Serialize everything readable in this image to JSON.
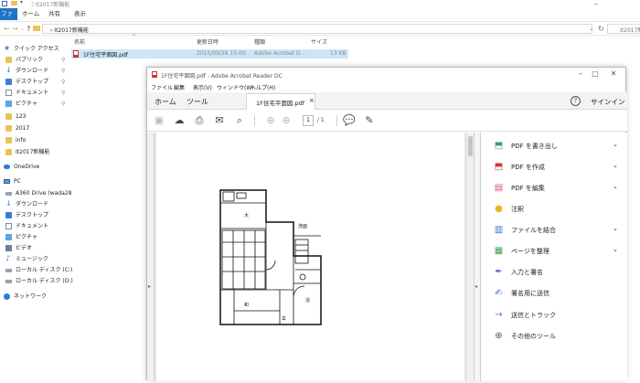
{
  "explorer": {
    "title": "ﾌ It2017新機能",
    "ribbon_tabs": [
      "ファイル",
      "ホーム",
      "共有",
      "表示"
    ],
    "address_path": "› It2017新機能",
    "search_placeholder": "It2017新機能",
    "columns": {
      "name": "名前",
      "date": "更新日時",
      "type": "種類",
      "size": "サイズ"
    },
    "file": {
      "name": "1F住宅平面図.pdf",
      "date": "2015/09/28 15:00",
      "type": "Adobe Acrobat D...",
      "size": "13 KB"
    },
    "nav": [
      {
        "label": "クイック アクセス",
        "icon": "star-icon"
      },
      {
        "label": "パブリック",
        "icon": "folder-icon",
        "pinned": true
      },
      {
        "label": "ダウンロード",
        "icon": "download-icon",
        "pinned": true
      },
      {
        "label": "デスクトップ",
        "icon": "desktop-icon",
        "pinned": true
      },
      {
        "label": "ドキュメント",
        "icon": "document-icon",
        "pinned": true
      },
      {
        "label": "ピクチャ",
        "icon": "pictures-icon",
        "pinned": true
      },
      {
        "label": "123",
        "icon": "folder-icon"
      },
      {
        "label": "2017",
        "icon": "folder-icon"
      },
      {
        "label": "info",
        "icon": "folder-icon"
      },
      {
        "label": "It2017新機能",
        "icon": "folder-icon"
      },
      {
        "label": "OneDrive",
        "icon": "onedrive-icon"
      },
      {
        "label": "PC",
        "icon": "pc-icon"
      },
      {
        "label": "A360 Drive (wada28",
        "icon": "drive-icon"
      },
      {
        "label": "ダウンロード",
        "icon": "download-icon"
      },
      {
        "label": "デスクトップ",
        "icon": "desktop-icon"
      },
      {
        "label": "ドキュメント",
        "icon": "document-icon"
      },
      {
        "label": "ピクチャ",
        "icon": "pictures-icon"
      },
      {
        "label": "ビデオ",
        "icon": "video-icon"
      },
      {
        "label": "ミュージック",
        "icon": "music-icon"
      },
      {
        "label": "ローカル ディスク (C:)",
        "icon": "disk-icon"
      },
      {
        "label": "ローカル ディスク (D:)",
        "icon": "disk-icon"
      },
      {
        "label": "ネットワーク",
        "icon": "network-icon"
      }
    ]
  },
  "acrobat": {
    "title": "1F住宅平面図.pdf - Adobe Acrobat Reader DC",
    "menu": [
      "ファイル",
      "編集",
      "表示(V)",
      "ウィンドウ(W)",
      "ヘルプ(H)"
    ],
    "top_tabs": {
      "home": "ホーム",
      "tools": "ツール",
      "doc": "1F住宅平面図.pdf",
      "close": "×"
    },
    "signin": "サインイン",
    "help": "?",
    "page_current": "1",
    "page_total": "/ 1",
    "tools": [
      {
        "label": "PDF を書き出し",
        "color": "#2da36a",
        "has_chevron": true
      },
      {
        "label": "PDF を作成",
        "color": "#d8332d",
        "has_chevron": true
      },
      {
        "label": "PDF を編集",
        "color": "#d84b8e",
        "has_chevron": true
      },
      {
        "label": "注釈",
        "color": "#e8b820",
        "has_chevron": false
      },
      {
        "label": "ファイルを結合",
        "color": "#3375c8",
        "has_chevron": true
      },
      {
        "label": "ページを整理",
        "color": "#3fa35c",
        "has_chevron": true
      },
      {
        "label": "入力と署名",
        "color": "#7b57b6",
        "has_chevron": false
      },
      {
        "label": "署名用に送信",
        "color": "#3468c0",
        "has_chevron": false
      },
      {
        "label": "送信とトラック",
        "color": "#3b83cc",
        "has_chevron": false
      },
      {
        "label": "その他のツール",
        "color": "#555555",
        "has_chevron": false
      }
    ],
    "floorplan_labels": {
      "room1": "大",
      "room2": "和",
      "room3": "浴",
      "room4": "洗面",
      "room5": "玄"
    }
  },
  "colors": {
    "accent": "#1e73c6",
    "selection": "#cce6f7"
  }
}
